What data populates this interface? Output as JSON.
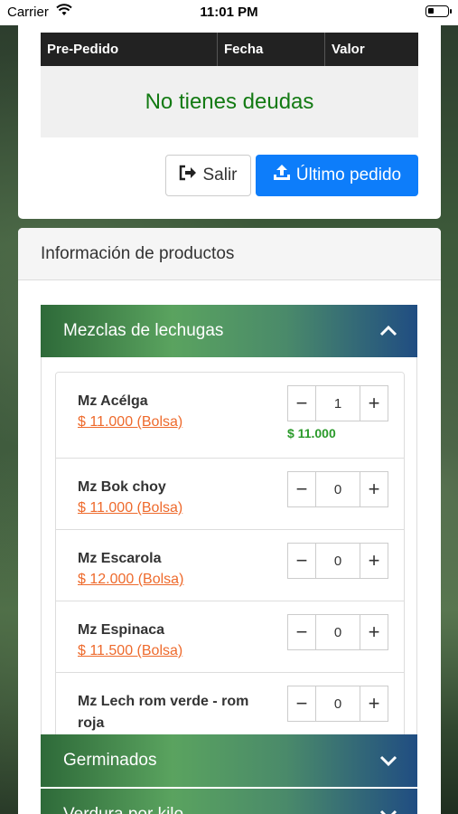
{
  "status": {
    "carrier": "Carrier",
    "time": "11:01 PM"
  },
  "debts": {
    "columns": [
      "Pre-Pedido",
      "Fecha",
      "Valor"
    ],
    "empty_message": "No tienes deudas",
    "logout_label": "Salir",
    "last_order_label": "Último pedido"
  },
  "products": {
    "title": "Información de productos",
    "categories": [
      {
        "label": "Mezclas de lechugas",
        "expanded": true
      },
      {
        "label": "Germinados",
        "expanded": false
      },
      {
        "label": "Verdura por kilo",
        "expanded": false
      }
    ],
    "items": [
      {
        "name": "Mz Acélga",
        "price": "$ 11.000 (Bolsa)",
        "qty": "1",
        "subtotal": "$ 11.000"
      },
      {
        "name": "Mz Bok choy",
        "price": "$ 11.000 (Bolsa)",
        "qty": "0"
      },
      {
        "name": "Mz Escarola",
        "price": "$ 12.000 (Bolsa)",
        "qty": "0"
      },
      {
        "name": "Mz Espinaca",
        "price": "$ 11.500 (Bolsa)",
        "qty": "0"
      },
      {
        "name": "Mz Lech rom verde - rom roja",
        "price": "",
        "qty": "0"
      }
    ]
  },
  "colors": {
    "primary": "#0d7dfa",
    "success_text": "#137a13",
    "price": "#ee6a2c"
  }
}
